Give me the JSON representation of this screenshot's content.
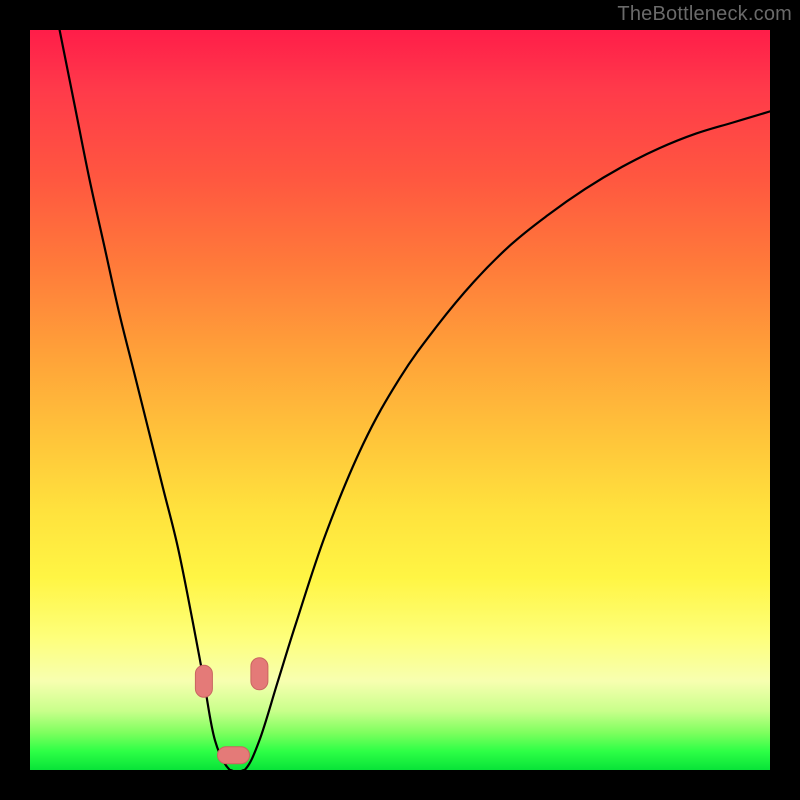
{
  "watermark": "TheBottleneck.com",
  "colors": {
    "page_bg": "#000000",
    "curve": "#000000",
    "marker_fill": "#e47a78",
    "marker_stroke": "#c96560",
    "gradient_stops": [
      "#ff1d49",
      "#ff3a4a",
      "#ff5740",
      "#ff7b3a",
      "#ffa239",
      "#ffc43a",
      "#ffe23d",
      "#fff544",
      "#feff7a",
      "#f7ffb0",
      "#c9ff8b",
      "#7dff5e",
      "#2dff46",
      "#08e338"
    ]
  },
  "chart_data": {
    "type": "line",
    "title": "",
    "xlabel": "",
    "ylabel": "",
    "xlim": [
      0,
      100
    ],
    "ylim": [
      0,
      100
    ],
    "series": [
      {
        "name": "bottleneck-curve",
        "x": [
          4,
          6,
          8,
          10,
          12,
          14,
          16,
          18,
          20,
          22,
          23.5,
          25,
          27,
          29,
          31,
          33.5,
          36,
          40,
          45,
          50,
          55,
          60,
          65,
          70,
          75,
          80,
          85,
          90,
          95,
          100
        ],
        "values": [
          100,
          90,
          80,
          71,
          62,
          54,
          46,
          38,
          30,
          20,
          12,
          4,
          0,
          0,
          4,
          12,
          20,
          32,
          44,
          53,
          60,
          66,
          71,
          75,
          78.5,
          81.5,
          84,
          86,
          87.5,
          89
        ]
      }
    ],
    "markers": [
      {
        "name": "left-node",
        "x": 23.5,
        "y": 12
      },
      {
        "name": "right-node",
        "x": 31,
        "y": 13
      },
      {
        "name": "bottom-node",
        "x": 27.5,
        "y": 2
      }
    ]
  }
}
